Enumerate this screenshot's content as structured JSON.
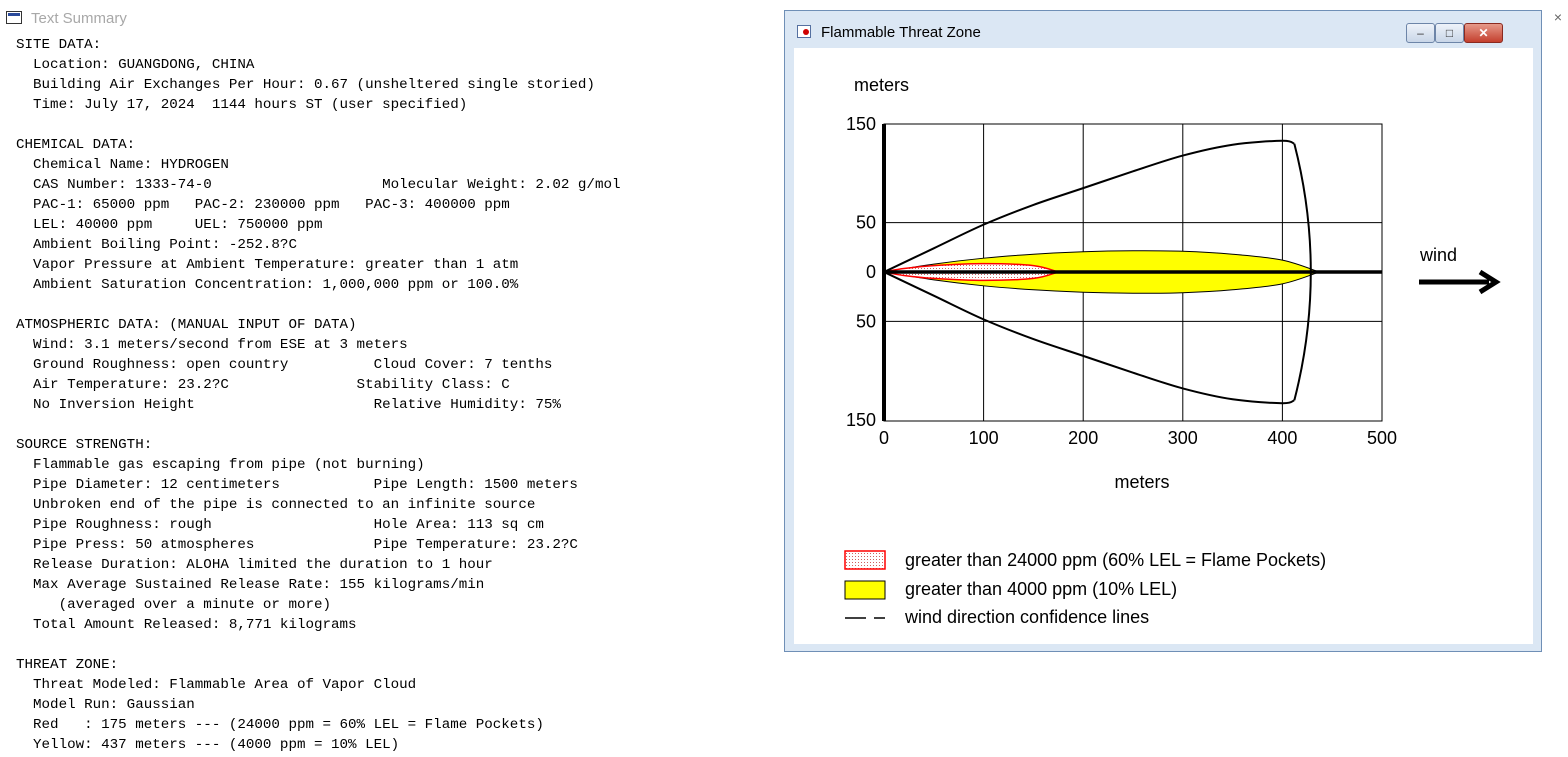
{
  "text_summary": {
    "title": "Text Summary",
    "close_glyph": "×",
    "lines": [
      "SITE DATA:",
      "  Location: GUANGDONG, CHINA",
      "  Building Air Exchanges Per Hour: 0.67 (unsheltered single storied)",
      "  Time: July 17, 2024  1144 hours ST (user specified)",
      "",
      "CHEMICAL DATA:",
      "  Chemical Name: HYDROGEN",
      "  CAS Number: 1333-74-0                    Molecular Weight: 2.02 g/mol",
      "  PAC-1: 65000 ppm   PAC-2: 230000 ppm   PAC-3: 400000 ppm",
      "  LEL: 40000 ppm     UEL: 750000 ppm",
      "  Ambient Boiling Point: -252.8?C",
      "  Vapor Pressure at Ambient Temperature: greater than 1 atm",
      "  Ambient Saturation Concentration: 1,000,000 ppm or 100.0%",
      "",
      "ATMOSPHERIC DATA: (MANUAL INPUT OF DATA)",
      "  Wind: 3.1 meters/second from ESE at 3 meters",
      "  Ground Roughness: open country          Cloud Cover: 7 tenths",
      "  Air Temperature: 23.2?C               Stability Class: C",
      "  No Inversion Height                     Relative Humidity: 75%",
      "",
      "SOURCE STRENGTH:",
      "  Flammable gas escaping from pipe (not burning)",
      "  Pipe Diameter: 12 centimeters           Pipe Length: 1500 meters",
      "  Unbroken end of the pipe is connected to an infinite source",
      "  Pipe Roughness: rough                   Hole Area: 113 sq cm",
      "  Pipe Press: 50 atmospheres              Pipe Temperature: 23.2?C",
      "  Release Duration: ALOHA limited the duration to 1 hour",
      "  Max Average Sustained Release Rate: 155 kilograms/min",
      "     (averaged over a minute or more)",
      "  Total Amount Released: 8,771 kilograms",
      "",
      "THREAT ZONE:",
      "  Threat Modeled: Flammable Area of Vapor Cloud",
      "  Model Run: Gaussian",
      "  Red   : 175 meters --- (24000 ppm = 60% LEL = Flame Pockets)",
      "  Yellow: 437 meters --- (4000 ppm = 10% LEL)"
    ]
  },
  "threat_window": {
    "title": "Flammable Threat Zone",
    "min_glyph": "–",
    "max_glyph": "□",
    "close_glyph": "✕",
    "wind_label": "wind",
    "legend": {
      "red": "greater than 24000 ppm (60% LEL = Flame Pockets)",
      "yellow": "greater than 4000 ppm (10% LEL)",
      "lines": "wind direction confidence lines"
    }
  },
  "chart_data": {
    "type": "area",
    "ylabel": "meters",
    "xlabel": "meters",
    "x_ticks": [
      "0",
      "100",
      "200",
      "300",
      "400",
      "500"
    ],
    "y_ticks": [
      "150",
      "50",
      "0",
      "50",
      "150"
    ],
    "xlim": [
      0,
      500
    ],
    "ylim": [
      -150,
      150
    ],
    "grid": true,
    "legend_placement": "bottom",
    "colors": {
      "red": "#ff0000",
      "yellow": "#ffff00",
      "lines": "#000000"
    },
    "series": [
      {
        "name": "greater than 24000 ppm (60% LEL = Flame Pockets)",
        "x": [
          0,
          20,
          50,
          100,
          150,
          175
        ],
        "y": [
          0,
          3.5,
          6.5,
          8.5,
          6.5,
          0
        ]
      },
      {
        "name": "greater than 4000 ppm (10% LEL)",
        "x": [
          0,
          50,
          100,
          150,
          200,
          250,
          300,
          350,
          400,
          437
        ],
        "y": [
          0,
          8,
          14,
          18,
          20.5,
          21.5,
          21,
          18,
          12,
          0
        ]
      },
      {
        "name": "wind direction confidence lines",
        "x": [
          0,
          50,
          100,
          150,
          200,
          250,
          300,
          350,
          400,
          412,
          437
        ],
        "y": [
          0,
          24,
          48,
          68,
          85,
          102,
          118,
          129,
          133,
          130,
          0
        ]
      }
    ]
  }
}
